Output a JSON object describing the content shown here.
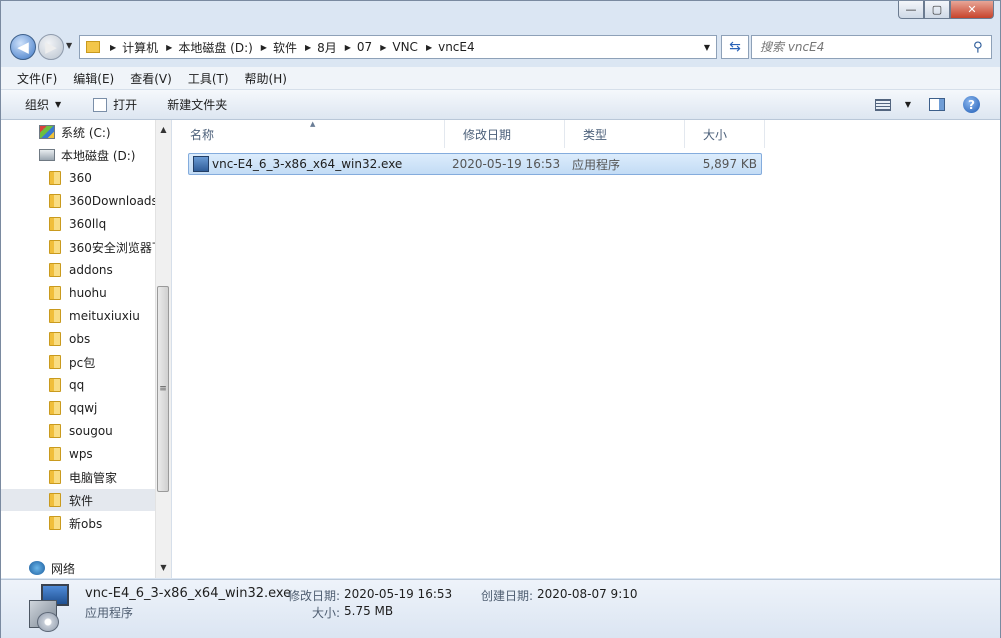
{
  "address": {
    "crumbs": [
      "计算机",
      "本地磁盘 (D:)",
      "软件",
      "8月",
      "07",
      "VNC",
      "vncE4"
    ]
  },
  "search": {
    "placeholder": "搜索 vncE4"
  },
  "menu": [
    "文件(F)",
    "编辑(E)",
    "查看(V)",
    "工具(T)",
    "帮助(H)"
  ],
  "toolbar": {
    "organize": "组织",
    "open": "打开",
    "new_folder": "新建文件夹"
  },
  "nav": {
    "items": [
      {
        "label": "系统 (C:)",
        "icon": "drive-c-icon"
      },
      {
        "label": "本地磁盘 (D:)",
        "icon": "drive-icon"
      },
      {
        "label": "360",
        "icon": "folder-icon"
      },
      {
        "label": "360Downloads",
        "icon": "folder-icon"
      },
      {
        "label": "360llq",
        "icon": "folder-icon"
      },
      {
        "label": "360安全浏览器下",
        "icon": "folder-icon"
      },
      {
        "label": "addons",
        "icon": "folder-icon"
      },
      {
        "label": "huohu",
        "icon": "folder-icon"
      },
      {
        "label": "meituxiuxiu",
        "icon": "folder-icon"
      },
      {
        "label": "obs",
        "icon": "folder-icon"
      },
      {
        "label": "pc包",
        "icon": "folder-icon"
      },
      {
        "label": "qq",
        "icon": "folder-icon"
      },
      {
        "label": "qqwj",
        "icon": "folder-icon"
      },
      {
        "label": "sougou",
        "icon": "folder-icon"
      },
      {
        "label": "wps",
        "icon": "folder-icon"
      },
      {
        "label": "电脑管家",
        "icon": "folder-icon"
      },
      {
        "label": "软件",
        "icon": "folder-icon",
        "selected": true
      },
      {
        "label": "新obs",
        "icon": "folder-icon"
      },
      {
        "label": "网络",
        "icon": "network-icon"
      }
    ]
  },
  "columns": {
    "name": "名称",
    "modified": "修改日期",
    "type": "类型",
    "size": "大小"
  },
  "files": [
    {
      "name": "vnc-E4_6_3-x86_x64_win32.exe",
      "modified": "2020-05-19 16:53",
      "type": "应用程序",
      "size": "5,897 KB",
      "selected": true
    }
  ],
  "details": {
    "filename": "vnc-E4_6_3-x86_x64_win32.exe",
    "filetype": "应用程序",
    "modified_label": "修改日期:",
    "modified_value": "2020-05-19 16:53",
    "created_label": "创建日期:",
    "created_value": "2020-08-07 9:10",
    "size_label": "大小:",
    "size_value": "5.75 MB"
  }
}
